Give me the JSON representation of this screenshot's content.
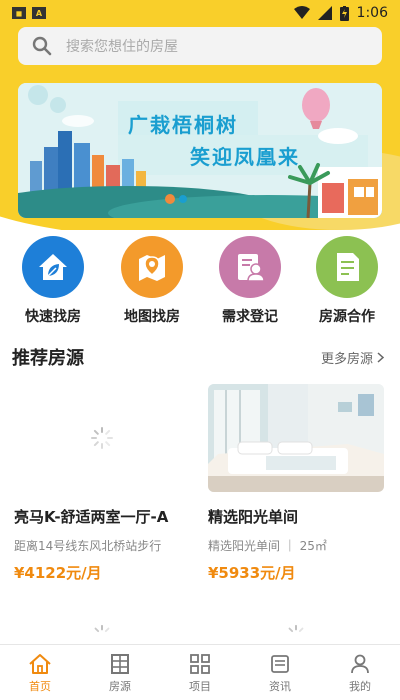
{
  "statusbar": {
    "time": "1:06"
  },
  "search": {
    "placeholder": "搜索您想住的房屋"
  },
  "banner": {
    "line1": "广栽梧桐树",
    "line2": "笑迎凤凰来"
  },
  "quick_actions": [
    {
      "label": "快速找房",
      "icon": "house-leaf-icon",
      "color": "#1e7fd8"
    },
    {
      "label": "地图找房",
      "icon": "map-pin-icon",
      "color": "#f39a2b"
    },
    {
      "label": "需求登记",
      "icon": "profile-card-icon",
      "color": "#c77aa9"
    },
    {
      "label": "房源合作",
      "icon": "document-icon",
      "color": "#8cc152"
    }
  ],
  "recommend": {
    "title": "推荐房源",
    "more": "更多房源",
    "listings": [
      {
        "title": "亮马K-舒适两室一厅-A",
        "meta": "距离14号线东风北桥站步行",
        "price": "¥4122元/月"
      },
      {
        "title": "精选阳光单间",
        "meta": "精选阳光单间 ｜ 25㎡",
        "price": "¥5933元/月"
      }
    ]
  },
  "tabbar": [
    {
      "label": "首页",
      "active": true
    },
    {
      "label": "房源",
      "active": false
    },
    {
      "label": "项目",
      "active": false
    },
    {
      "label": "资讯",
      "active": false
    },
    {
      "label": "我的",
      "active": false
    }
  ],
  "colors": {
    "brand_yellow": "#f9cf2a",
    "accent_orange": "#f08a0f",
    "banner_text": "#1a9ed0"
  }
}
